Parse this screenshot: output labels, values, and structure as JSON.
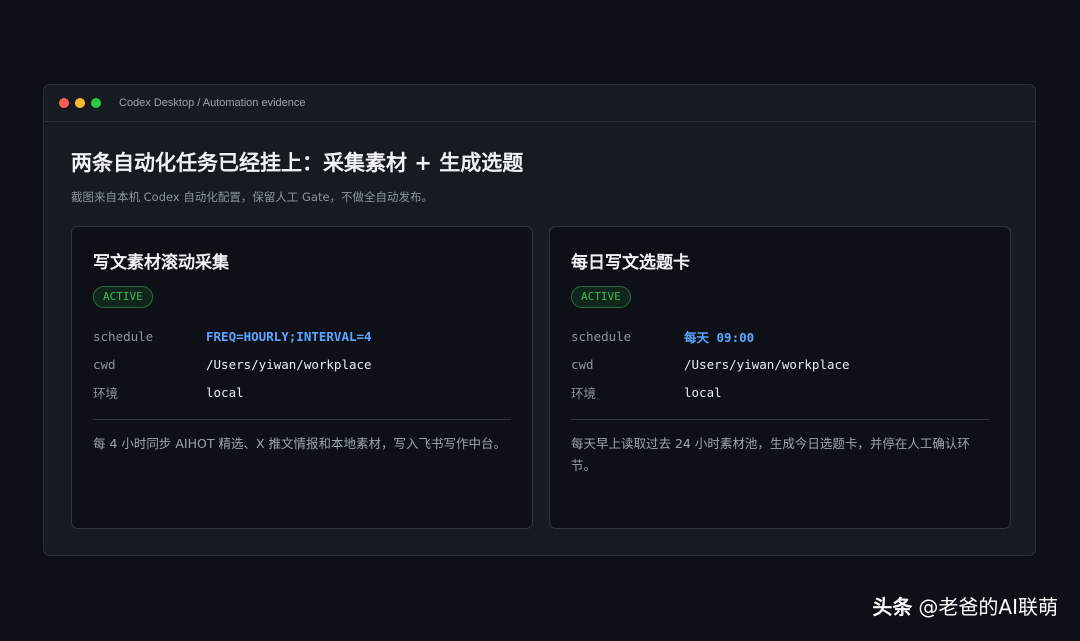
{
  "window": {
    "title": "Codex Desktop / Automation evidence",
    "controls": {
      "close_color": "#ff5f57",
      "minimize_color": "#febc2e",
      "maximize_color": "#28c840"
    }
  },
  "page": {
    "title": "两条自动化任务已经挂上：采集素材 + 生成选题",
    "subtitle": "截图来自本机 Codex 自动化配置，保留人工 Gate，不做全自动发布。"
  },
  "cards": [
    {
      "title": "写文素材滚动采集",
      "status": "ACTIVE",
      "fields": [
        {
          "key": "schedule",
          "value": "FREQ=HOURLY;INTERVAL=4"
        },
        {
          "key": "cwd",
          "value": "/Users/yiwan/workplace"
        },
        {
          "key": "环境",
          "value": "local"
        }
      ],
      "description": "每 4 小时同步 AIHOT 精选、X 推文情报和本地素材，写入飞书写作中台。"
    },
    {
      "title": "每日写文选题卡",
      "status": "ACTIVE",
      "fields": [
        {
          "key": "schedule",
          "value": "每天 09:00"
        },
        {
          "key": "cwd",
          "value": "/Users/yiwan/workplace"
        },
        {
          "key": "环境",
          "value": "local"
        }
      ],
      "description": "每天早上读取过去 24 小时素材池，生成今日选题卡，并停在人工确认环节。"
    }
  ],
  "watermark": {
    "brand": "头条",
    "handle": "@老爸的AI联萌"
  },
  "colors": {
    "background": "#0d1016",
    "window_bg": "#161b22",
    "card_bg": "#0d1117",
    "accent_blue": "#58a6ff",
    "status_green": "#3fb950"
  }
}
